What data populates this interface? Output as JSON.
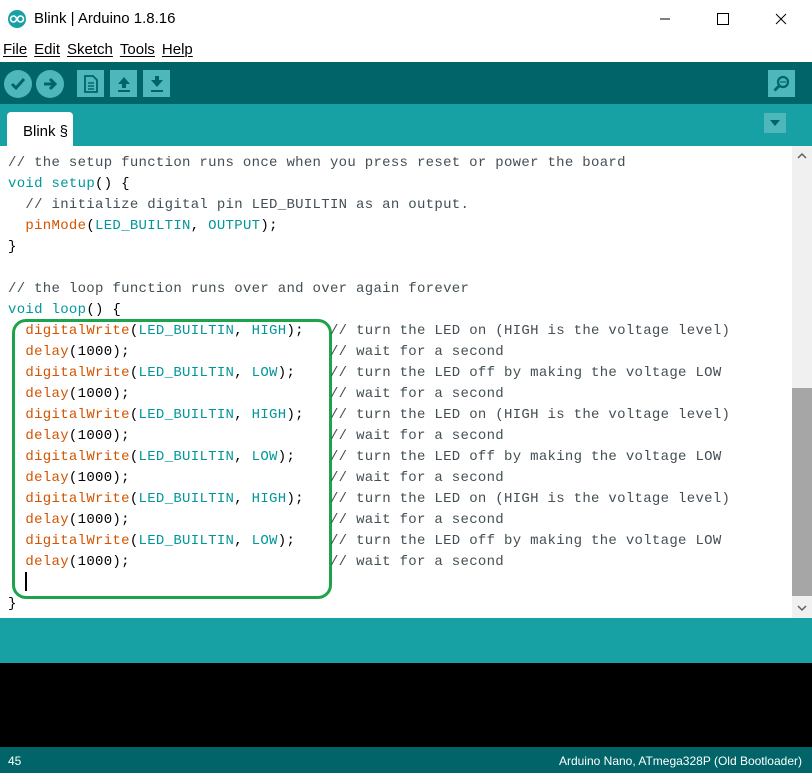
{
  "window": {
    "title": "Blink | Arduino 1.8.16"
  },
  "menu": [
    {
      "label": "File"
    },
    {
      "label": "Edit"
    },
    {
      "label": "Sketch"
    },
    {
      "label": "Tools"
    },
    {
      "label": "Help"
    }
  ],
  "toolbar": {
    "buttons": [
      "verify-icon",
      "upload-icon",
      "new-icon",
      "open-icon",
      "save-icon"
    ],
    "right_button": "serial-monitor-icon"
  },
  "tabs": [
    {
      "label": "Blink §"
    }
  ],
  "editor": {
    "lines": [
      [
        {
          "t": "// the setup function runs once when you press reset or power the board",
          "c": "cmt"
        }
      ],
      [
        {
          "t": "void",
          "c": "kw"
        },
        {
          "t": " "
        },
        {
          "t": "setup",
          "c": "kw"
        },
        {
          "t": "() {"
        }
      ],
      [
        {
          "t": "  // initialize digital pin LED_BUILTIN as an output.",
          "c": "cmt"
        }
      ],
      [
        {
          "t": "  "
        },
        {
          "t": "pinMode",
          "c": "fn"
        },
        {
          "t": "("
        },
        {
          "t": "LED_BUILTIN",
          "c": "const"
        },
        {
          "t": ", "
        },
        {
          "t": "OUTPUT",
          "c": "const"
        },
        {
          "t": ");"
        }
      ],
      [
        {
          "t": "}"
        }
      ],
      [
        {
          "t": ""
        }
      ],
      [
        {
          "t": "// the loop function runs over and over again forever",
          "c": "cmt"
        }
      ],
      [
        {
          "t": "void",
          "c": "kw"
        },
        {
          "t": " "
        },
        {
          "t": "loop",
          "c": "kw"
        },
        {
          "t": "() {"
        }
      ],
      [
        {
          "t": "  "
        },
        {
          "t": "digitalWrite",
          "c": "fn"
        },
        {
          "t": "("
        },
        {
          "t": "LED_BUILTIN",
          "c": "const"
        },
        {
          "t": ", "
        },
        {
          "t": "HIGH",
          "c": "const"
        },
        {
          "t": ");   "
        },
        {
          "t": "// turn the LED on (HIGH is the voltage level)",
          "c": "cmt"
        }
      ],
      [
        {
          "t": "  "
        },
        {
          "t": "delay",
          "c": "fn"
        },
        {
          "t": "(1000);                       "
        },
        {
          "t": "// wait for a second",
          "c": "cmt"
        }
      ],
      [
        {
          "t": "  "
        },
        {
          "t": "digitalWrite",
          "c": "fn"
        },
        {
          "t": "("
        },
        {
          "t": "LED_BUILTIN",
          "c": "const"
        },
        {
          "t": ", "
        },
        {
          "t": "LOW",
          "c": "const"
        },
        {
          "t": ");    "
        },
        {
          "t": "// turn the LED off by making the voltage LOW",
          "c": "cmt"
        }
      ],
      [
        {
          "t": "  "
        },
        {
          "t": "delay",
          "c": "fn"
        },
        {
          "t": "(1000);                       "
        },
        {
          "t": "// wait for a second",
          "c": "cmt"
        }
      ],
      [
        {
          "t": "  "
        },
        {
          "t": "digitalWrite",
          "c": "fn"
        },
        {
          "t": "("
        },
        {
          "t": "LED_BUILTIN",
          "c": "const"
        },
        {
          "t": ", "
        },
        {
          "t": "HIGH",
          "c": "const"
        },
        {
          "t": ");   "
        },
        {
          "t": "// turn the LED on (HIGH is the voltage level)",
          "c": "cmt"
        }
      ],
      [
        {
          "t": "  "
        },
        {
          "t": "delay",
          "c": "fn"
        },
        {
          "t": "(1000);                       "
        },
        {
          "t": "// wait for a second",
          "c": "cmt"
        }
      ],
      [
        {
          "t": "  "
        },
        {
          "t": "digitalWrite",
          "c": "fn"
        },
        {
          "t": "("
        },
        {
          "t": "LED_BUILTIN",
          "c": "const"
        },
        {
          "t": ", "
        },
        {
          "t": "LOW",
          "c": "const"
        },
        {
          "t": ");    "
        },
        {
          "t": "// turn the LED off by making the voltage LOW",
          "c": "cmt"
        }
      ],
      [
        {
          "t": "  "
        },
        {
          "t": "delay",
          "c": "fn"
        },
        {
          "t": "(1000);                       "
        },
        {
          "t": "// wait for a second",
          "c": "cmt"
        }
      ],
      [
        {
          "t": "  "
        },
        {
          "t": "digitalWrite",
          "c": "fn"
        },
        {
          "t": "("
        },
        {
          "t": "LED_BUILTIN",
          "c": "const"
        },
        {
          "t": ", "
        },
        {
          "t": "HIGH",
          "c": "const"
        },
        {
          "t": ");   "
        },
        {
          "t": "// turn the LED on (HIGH is the voltage level)",
          "c": "cmt"
        }
      ],
      [
        {
          "t": "  "
        },
        {
          "t": "delay",
          "c": "fn"
        },
        {
          "t": "(1000);                       "
        },
        {
          "t": "// wait for a second",
          "c": "cmt"
        }
      ],
      [
        {
          "t": "  "
        },
        {
          "t": "digitalWrite",
          "c": "fn"
        },
        {
          "t": "("
        },
        {
          "t": "LED_BUILTIN",
          "c": "const"
        },
        {
          "t": ", "
        },
        {
          "t": "LOW",
          "c": "const"
        },
        {
          "t": ");    "
        },
        {
          "t": "// turn the LED off by making the voltage LOW",
          "c": "cmt"
        }
      ],
      [
        {
          "t": "  "
        },
        {
          "t": "delay",
          "c": "fn"
        },
        {
          "t": "(1000);                       "
        },
        {
          "t": "// wait for a second",
          "c": "cmt"
        }
      ],
      [
        {
          "t": ""
        }
      ],
      [
        {
          "t": "}"
        }
      ]
    ],
    "highlight_color": "#1da44a"
  },
  "status": {
    "line_number": "45",
    "board": "Arduino Nano, ATmega328P (Old Bootloader)"
  },
  "colors": {
    "toolbar_bg": "#006468",
    "tab_strip_bg": "#17a1a5",
    "button_bg": "#4db7bb",
    "comment": "#434f54",
    "keyword": "#00979c",
    "function": "#d35400"
  }
}
